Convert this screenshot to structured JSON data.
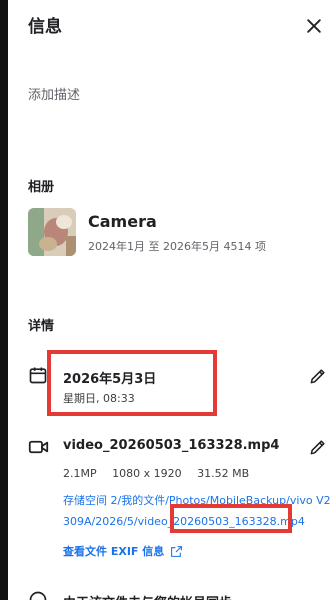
{
  "header": {
    "title": "信息"
  },
  "description": {
    "placeholder": "添加描述"
  },
  "album": {
    "section_title": "相册",
    "name": "Camera",
    "meta": "2024年1月 至 2026年5月   4514 项"
  },
  "details": {
    "section_title": "详情",
    "date": "2026年5月3日",
    "day_time": "星期日, 08:33",
    "file_name": "video_20260503_163328.mp4",
    "resolution_mp": "2.1MP",
    "dimensions": "1080 x 1920",
    "file_size": "31.52 MB",
    "path": "存储空间 2/我的文件/Photos/MobileBackup/vivo V2309A/2026/5/video_20260503_163328.mp4",
    "exif_link": "查看文件 EXIF 信息",
    "next_row_text": "由于该文件未与您的帐号同步"
  },
  "colors": {
    "accent": "#1a73e8",
    "highlight": "#e53935"
  },
  "icons": {
    "close": "close-icon",
    "calendar": "calendar-icon",
    "video": "video-icon",
    "edit": "pencil-icon",
    "external": "external-link-icon",
    "info": "info-icon"
  }
}
